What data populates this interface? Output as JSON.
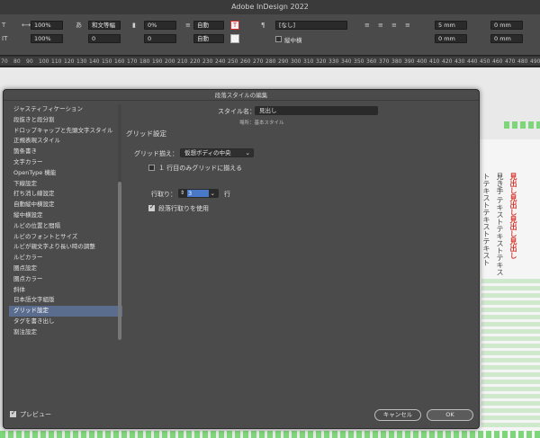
{
  "app": {
    "title": "Adobe InDesign 2022"
  },
  "control_panel": {
    "row1": {
      "font_size": "100%",
      "kern_pct": "100%",
      "mojikumi": "和文等幅",
      "tracking": "0%",
      "auto1": "自動",
      "style": "[なし]",
      "mm1": "5 mm",
      "mm2": "0 mm"
    },
    "row2": {
      "leading_pct": "100%",
      "kern": "0",
      "tsume": "0",
      "auto2": "自動",
      "tate_chu_yoko": "縦中横",
      "mm3": "0 mm",
      "mm4": "0 mm"
    }
  },
  "ruler": {
    "ticks": [
      "70",
      "80",
      "90",
      "100",
      "110",
      "120",
      "130",
      "140",
      "150",
      "160",
      "170",
      "180",
      "190",
      "200",
      "210",
      "220",
      "230",
      "240",
      "250",
      "260",
      "270",
      "280",
      "290",
      "300",
      "310",
      "320",
      "330",
      "340",
      "350",
      "360",
      "370",
      "380",
      "390",
      "400",
      "410",
      "420",
      "430",
      "440",
      "450",
      "460",
      "470",
      "480",
      "490"
    ]
  },
  "dialog": {
    "title": "段落スタイルの編集",
    "style_name_label": "スタイル名：",
    "style_name_value": "見出し",
    "location": "場所：基本スタイル",
    "section_title": "グリッド設定",
    "sidebar": [
      "ジャスティフィケーション",
      "段抜きと段分割",
      "ドロップキャップと先頭文字スタイル",
      "正規表現スタイル",
      "箇条書き",
      "文字カラー",
      "OpenType 機能",
      "下線設定",
      "打ち消し線設定",
      "自動縦中横設定",
      "縦中横設定",
      "ルビの位置と間隔",
      "ルビのフォントとサイズ",
      "ルビが親文字より長い時の調整",
      "ルビカラー",
      "圏点設定",
      "圏点カラー",
      "斜体",
      "日本語文字組版",
      "グリッド設定",
      "タグを書き出し",
      "割注設定"
    ],
    "selected_index": 19,
    "grid_align_label": "グリッド揃え：",
    "grid_align_value": "仮想ボディの中央",
    "first_line_only": "１ 行目のみグリッドに揃える",
    "first_line_checked": false,
    "lines_label": "行取り：",
    "lines_value": "3",
    "lines_unit": "行",
    "paragraph_lines": "段落行取りを使用",
    "paragraph_lines_checked": true,
    "preview_label": "プレビュー",
    "preview_checked": true,
    "cancel_label": "キャンセル",
    "ok_label": "OK"
  },
  "document": {
    "col1": "トテキストテキストテキスト",
    "col2": "見き手 テキストテキストテキス",
    "col3": "見出し見出し見出し見出し"
  },
  "colors": {
    "accent": "#5a6d8f",
    "grid_green": "#7ed67a",
    "heading_red": "#d6372e"
  }
}
